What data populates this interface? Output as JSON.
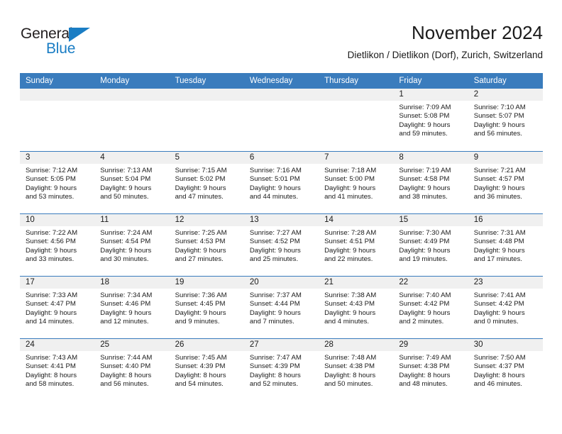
{
  "brand": {
    "name_part1": "General",
    "name_part2": "Blue",
    "triangle_color": "#1a7dc4",
    "text_color": "#231f20"
  },
  "header": {
    "title": "November 2024",
    "subtitle": "Dietlikon / Dietlikon (Dorf), Zurich, Switzerland"
  },
  "theme": {
    "accent_blue": "#3a7cbd",
    "day_band_gray": "#f0f0f0",
    "text": "#1a1a1a"
  },
  "calendar": {
    "weekdays": [
      "Sunday",
      "Monday",
      "Tuesday",
      "Wednesday",
      "Thursday",
      "Friday",
      "Saturday"
    ],
    "weeks": [
      [
        {
          "day": "",
          "sunrise": "",
          "sunset": "",
          "daylight_line1": "",
          "daylight_line2": ""
        },
        {
          "day": "",
          "sunrise": "",
          "sunset": "",
          "daylight_line1": "",
          "daylight_line2": ""
        },
        {
          "day": "",
          "sunrise": "",
          "sunset": "",
          "daylight_line1": "",
          "daylight_line2": ""
        },
        {
          "day": "",
          "sunrise": "",
          "sunset": "",
          "daylight_line1": "",
          "daylight_line2": ""
        },
        {
          "day": "",
          "sunrise": "",
          "sunset": "",
          "daylight_line1": "",
          "daylight_line2": ""
        },
        {
          "day": "1",
          "sunrise": "Sunrise: 7:09 AM",
          "sunset": "Sunset: 5:08 PM",
          "daylight_line1": "Daylight: 9 hours",
          "daylight_line2": "and 59 minutes."
        },
        {
          "day": "2",
          "sunrise": "Sunrise: 7:10 AM",
          "sunset": "Sunset: 5:07 PM",
          "daylight_line1": "Daylight: 9 hours",
          "daylight_line2": "and 56 minutes."
        }
      ],
      [
        {
          "day": "3",
          "sunrise": "Sunrise: 7:12 AM",
          "sunset": "Sunset: 5:05 PM",
          "daylight_line1": "Daylight: 9 hours",
          "daylight_line2": "and 53 minutes."
        },
        {
          "day": "4",
          "sunrise": "Sunrise: 7:13 AM",
          "sunset": "Sunset: 5:04 PM",
          "daylight_line1": "Daylight: 9 hours",
          "daylight_line2": "and 50 minutes."
        },
        {
          "day": "5",
          "sunrise": "Sunrise: 7:15 AM",
          "sunset": "Sunset: 5:02 PM",
          "daylight_line1": "Daylight: 9 hours",
          "daylight_line2": "and 47 minutes."
        },
        {
          "day": "6",
          "sunrise": "Sunrise: 7:16 AM",
          "sunset": "Sunset: 5:01 PM",
          "daylight_line1": "Daylight: 9 hours",
          "daylight_line2": "and 44 minutes."
        },
        {
          "day": "7",
          "sunrise": "Sunrise: 7:18 AM",
          "sunset": "Sunset: 5:00 PM",
          "daylight_line1": "Daylight: 9 hours",
          "daylight_line2": "and 41 minutes."
        },
        {
          "day": "8",
          "sunrise": "Sunrise: 7:19 AM",
          "sunset": "Sunset: 4:58 PM",
          "daylight_line1": "Daylight: 9 hours",
          "daylight_line2": "and 38 minutes."
        },
        {
          "day": "9",
          "sunrise": "Sunrise: 7:21 AM",
          "sunset": "Sunset: 4:57 PM",
          "daylight_line1": "Daylight: 9 hours",
          "daylight_line2": "and 36 minutes."
        }
      ],
      [
        {
          "day": "10",
          "sunrise": "Sunrise: 7:22 AM",
          "sunset": "Sunset: 4:56 PM",
          "daylight_line1": "Daylight: 9 hours",
          "daylight_line2": "and 33 minutes."
        },
        {
          "day": "11",
          "sunrise": "Sunrise: 7:24 AM",
          "sunset": "Sunset: 4:54 PM",
          "daylight_line1": "Daylight: 9 hours",
          "daylight_line2": "and 30 minutes."
        },
        {
          "day": "12",
          "sunrise": "Sunrise: 7:25 AM",
          "sunset": "Sunset: 4:53 PM",
          "daylight_line1": "Daylight: 9 hours",
          "daylight_line2": "and 27 minutes."
        },
        {
          "day": "13",
          "sunrise": "Sunrise: 7:27 AM",
          "sunset": "Sunset: 4:52 PM",
          "daylight_line1": "Daylight: 9 hours",
          "daylight_line2": "and 25 minutes."
        },
        {
          "day": "14",
          "sunrise": "Sunrise: 7:28 AM",
          "sunset": "Sunset: 4:51 PM",
          "daylight_line1": "Daylight: 9 hours",
          "daylight_line2": "and 22 minutes."
        },
        {
          "day": "15",
          "sunrise": "Sunrise: 7:30 AM",
          "sunset": "Sunset: 4:49 PM",
          "daylight_line1": "Daylight: 9 hours",
          "daylight_line2": "and 19 minutes."
        },
        {
          "day": "16",
          "sunrise": "Sunrise: 7:31 AM",
          "sunset": "Sunset: 4:48 PM",
          "daylight_line1": "Daylight: 9 hours",
          "daylight_line2": "and 17 minutes."
        }
      ],
      [
        {
          "day": "17",
          "sunrise": "Sunrise: 7:33 AM",
          "sunset": "Sunset: 4:47 PM",
          "daylight_line1": "Daylight: 9 hours",
          "daylight_line2": "and 14 minutes."
        },
        {
          "day": "18",
          "sunrise": "Sunrise: 7:34 AM",
          "sunset": "Sunset: 4:46 PM",
          "daylight_line1": "Daylight: 9 hours",
          "daylight_line2": "and 12 minutes."
        },
        {
          "day": "19",
          "sunrise": "Sunrise: 7:36 AM",
          "sunset": "Sunset: 4:45 PM",
          "daylight_line1": "Daylight: 9 hours",
          "daylight_line2": "and 9 minutes."
        },
        {
          "day": "20",
          "sunrise": "Sunrise: 7:37 AM",
          "sunset": "Sunset: 4:44 PM",
          "daylight_line1": "Daylight: 9 hours",
          "daylight_line2": "and 7 minutes."
        },
        {
          "day": "21",
          "sunrise": "Sunrise: 7:38 AM",
          "sunset": "Sunset: 4:43 PM",
          "daylight_line1": "Daylight: 9 hours",
          "daylight_line2": "and 4 minutes."
        },
        {
          "day": "22",
          "sunrise": "Sunrise: 7:40 AM",
          "sunset": "Sunset: 4:42 PM",
          "daylight_line1": "Daylight: 9 hours",
          "daylight_line2": "and 2 minutes."
        },
        {
          "day": "23",
          "sunrise": "Sunrise: 7:41 AM",
          "sunset": "Sunset: 4:42 PM",
          "daylight_line1": "Daylight: 9 hours",
          "daylight_line2": "and 0 minutes."
        }
      ],
      [
        {
          "day": "24",
          "sunrise": "Sunrise: 7:43 AM",
          "sunset": "Sunset: 4:41 PM",
          "daylight_line1": "Daylight: 8 hours",
          "daylight_line2": "and 58 minutes."
        },
        {
          "day": "25",
          "sunrise": "Sunrise: 7:44 AM",
          "sunset": "Sunset: 4:40 PM",
          "daylight_line1": "Daylight: 8 hours",
          "daylight_line2": "and 56 minutes."
        },
        {
          "day": "26",
          "sunrise": "Sunrise: 7:45 AM",
          "sunset": "Sunset: 4:39 PM",
          "daylight_line1": "Daylight: 8 hours",
          "daylight_line2": "and 54 minutes."
        },
        {
          "day": "27",
          "sunrise": "Sunrise: 7:47 AM",
          "sunset": "Sunset: 4:39 PM",
          "daylight_line1": "Daylight: 8 hours",
          "daylight_line2": "and 52 minutes."
        },
        {
          "day": "28",
          "sunrise": "Sunrise: 7:48 AM",
          "sunset": "Sunset: 4:38 PM",
          "daylight_line1": "Daylight: 8 hours",
          "daylight_line2": "and 50 minutes."
        },
        {
          "day": "29",
          "sunrise": "Sunrise: 7:49 AM",
          "sunset": "Sunset: 4:38 PM",
          "daylight_line1": "Daylight: 8 hours",
          "daylight_line2": "and 48 minutes."
        },
        {
          "day": "30",
          "sunrise": "Sunrise: 7:50 AM",
          "sunset": "Sunset: 4:37 PM",
          "daylight_line1": "Daylight: 8 hours",
          "daylight_line2": "and 46 minutes."
        }
      ]
    ]
  }
}
